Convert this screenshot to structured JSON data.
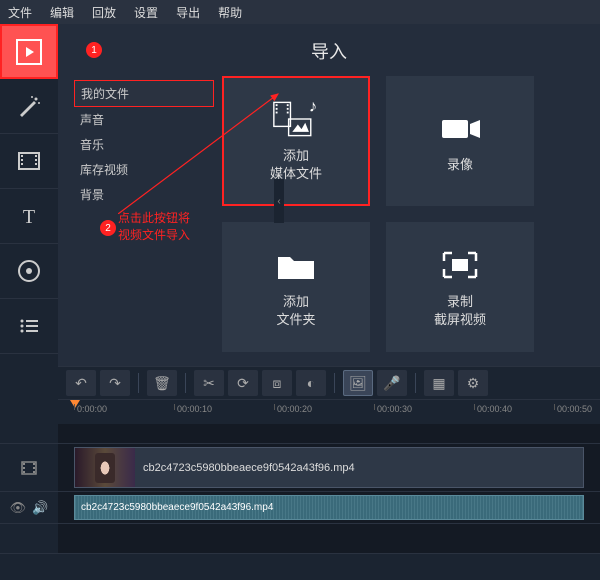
{
  "menu": {
    "file": "文件",
    "edit": "编辑",
    "playback": "回放",
    "settings": "设置",
    "export": "导出",
    "help": "帮助"
  },
  "panel": {
    "title": "导入"
  },
  "sidemenu": {
    "my_files": "我的文件",
    "sounds": "声音",
    "music": "音乐",
    "stock_video": "库存视频",
    "backgrounds": "背景"
  },
  "tiles": {
    "add_media": "添加\n媒体文件",
    "record_cam": "录像",
    "add_folder": "添加\n文件夹",
    "record_screen": "录制\n截屏视频"
  },
  "annotations": {
    "marker1": "1",
    "marker2": "2",
    "instruction": "点击此按钮将\n视频文件导入"
  },
  "ruler": {
    "t0": "0:00:00",
    "t1": "00:00:10",
    "t2": "00:00:20",
    "t3": "00:00:30",
    "t4": "00:00:40",
    "t5": "00:00:50"
  },
  "clip": {
    "filename": "cb2c4723c5980bbeaece9f0542a43f96.mp4"
  }
}
